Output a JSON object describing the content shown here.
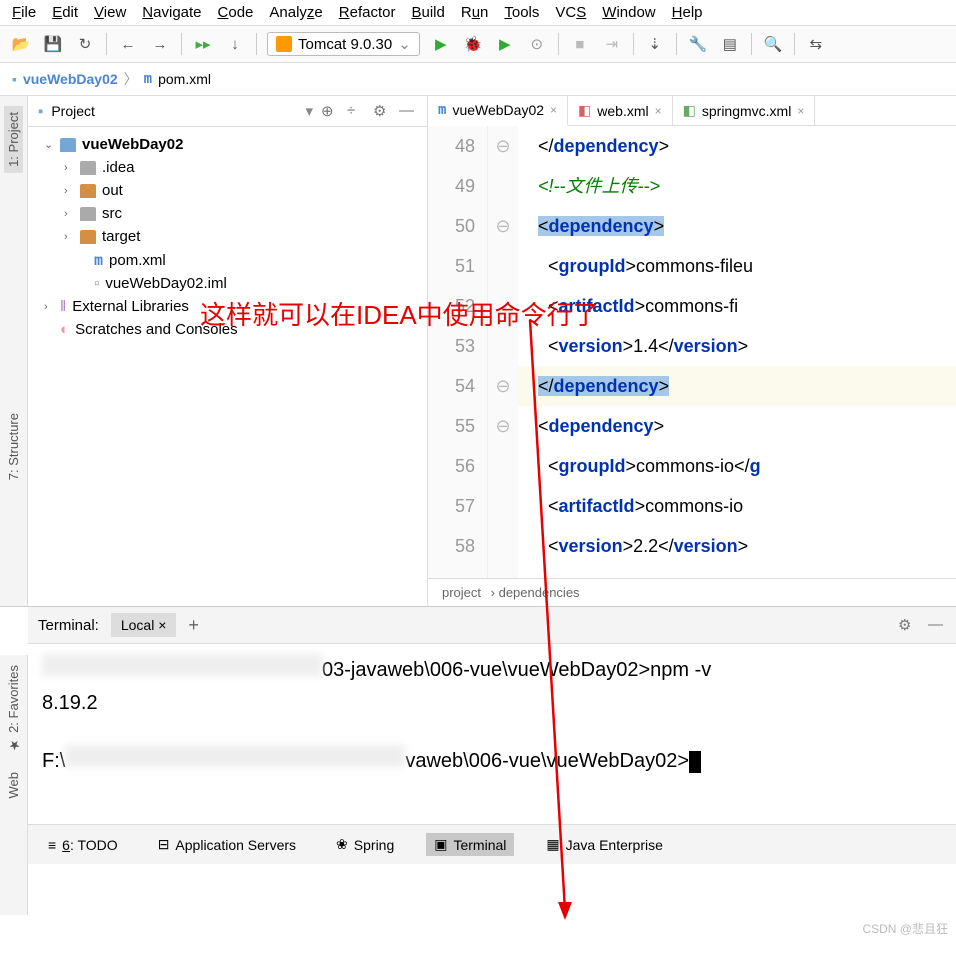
{
  "menu": [
    "File",
    "Edit",
    "View",
    "Navigate",
    "Code",
    "Analyze",
    "Refactor",
    "Build",
    "Run",
    "Tools",
    "VCS",
    "Window",
    "Help"
  ],
  "runConfig": "Tomcat 9.0.30",
  "breadcrumb": {
    "root": "vueWebDay02",
    "file": "pom.xml"
  },
  "projectPanel": {
    "title": "Project"
  },
  "tree": {
    "root": "vueWebDay02",
    "items": [
      {
        "name": ".idea",
        "type": "folder-grey",
        "chev": "›"
      },
      {
        "name": "out",
        "type": "folder-orange",
        "chev": "›"
      },
      {
        "name": "src",
        "type": "folder-grey",
        "chev": "›"
      },
      {
        "name": "target",
        "type": "folder-orange",
        "chev": "›"
      },
      {
        "name": "pom.xml",
        "type": "file-m"
      },
      {
        "name": "vueWebDay02.iml",
        "type": "file"
      }
    ],
    "extLib": "External Libraries",
    "scratch": "Scratches and Consoles"
  },
  "tabs": [
    {
      "label": "vueWebDay02",
      "icon": "m",
      "active": true
    },
    {
      "label": "web.xml",
      "icon": "xml"
    },
    {
      "label": "springmvc.xml",
      "icon": "xml"
    }
  ],
  "lineNumbers": [
    48,
    49,
    50,
    51,
    52,
    53,
    54,
    55,
    56,
    57,
    58
  ],
  "code": {
    "l48": {
      "pre": "</",
      "tag": "dependency",
      "post": ">"
    },
    "l49": "<!--文件上传-->",
    "l50": {
      "pre": "<",
      "tag": "dependency",
      "post": ">"
    },
    "l51": {
      "pre": "<",
      "tag": "groupId",
      "mid": ">commons-fileu"
    },
    "l52": {
      "pre": "<",
      "tag": "artifactId",
      "mid": ">commons-fi"
    },
    "l53": {
      "pre": "<",
      "tag": "version",
      "mid": ">1.4</",
      "tag2": "version",
      "post": ">"
    },
    "l54": {
      "pre": "</",
      "tag": "dependency",
      "post": ">"
    },
    "l55": {
      "pre": "<",
      "tag": "dependency",
      "post": ">"
    },
    "l56": {
      "pre": "<",
      "tag": "groupId",
      "mid": ">commons-io</",
      "tag2": "g"
    },
    "l57": {
      "pre": "<",
      "tag": "artifactId",
      "mid": ">commons-io"
    },
    "l58": {
      "pre": "<",
      "tag": "version",
      "mid": ">2.2</",
      "tag2": "version",
      "post": ">"
    }
  },
  "editorCrumb": [
    "project",
    "dependencies"
  ],
  "terminal": {
    "title": "Terminal:",
    "tab": "Local",
    "line1_suffix": "03-javaweb\\006-vue\\vueWebDay02>npm -v",
    "line2": "8.19.2",
    "line3_pre": "F:\\",
    "line3_suffix": "vaweb\\006-vue\\vueWebDay02>"
  },
  "bottomTabs": [
    {
      "label": "6: TODO",
      "icon": "≡"
    },
    {
      "label": "Application Servers",
      "icon": "⊟"
    },
    {
      "label": "Spring",
      "icon": "❀"
    },
    {
      "label": "Terminal",
      "icon": "▣",
      "active": true
    },
    {
      "label": "Java Enterprise",
      "icon": "▦"
    }
  ],
  "annotation": "这样就可以在IDEA中使用命令行了",
  "watermark": "CSDN @悲且狂",
  "vtabs": {
    "project": "1: Project",
    "structure": "7: Structure",
    "favorites": "2: Favorites",
    "web": "Web"
  }
}
